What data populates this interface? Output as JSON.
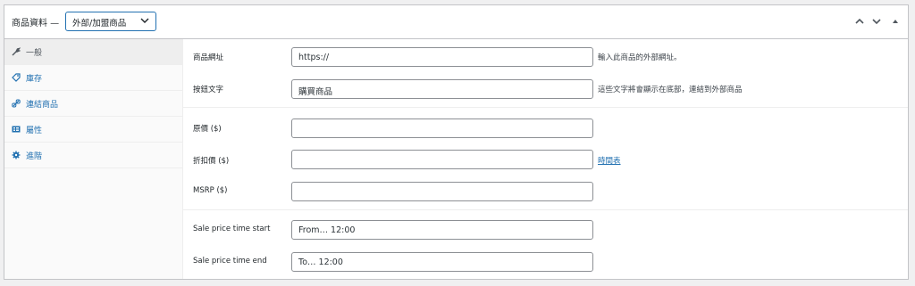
{
  "header": {
    "title": "商品資料 —",
    "product_type": "外部/加盟商品",
    "icons": [
      "chevron-up-icon",
      "chevron-down-icon",
      "triangle-up-icon"
    ]
  },
  "tabs": [
    {
      "label": "一般",
      "icon": "wrench-icon"
    },
    {
      "label": "庫存",
      "icon": "tag-icon"
    },
    {
      "label": "連結商品",
      "icon": "link-icon"
    },
    {
      "label": "屬性",
      "icon": "table-icon"
    },
    {
      "label": "進階",
      "icon": "gear-icon"
    }
  ],
  "general": {
    "product_url": {
      "label": "商品網址",
      "value": "https://",
      "hint": "輸入此商品的外部網址。"
    },
    "button_text": {
      "label": "按鈕文字",
      "value": "購買商品",
      "hint": "這些文字將會顯示在底部，連結到外部商品"
    },
    "regular_price": {
      "label": "原價 ($)",
      "value": ""
    },
    "sale_price": {
      "label": "折扣價 ($)",
      "value": "",
      "link": "時間表"
    },
    "msrp": {
      "label": "MSRP ($)",
      "value": ""
    },
    "sale_start": {
      "label": "Sale price time start",
      "value": "From… 12:00"
    },
    "sale_end": {
      "label": "Sale price time end",
      "value": "To… 12:00"
    }
  },
  "colors": {
    "accent": "#2271b1",
    "border": "#c3c4c7"
  }
}
